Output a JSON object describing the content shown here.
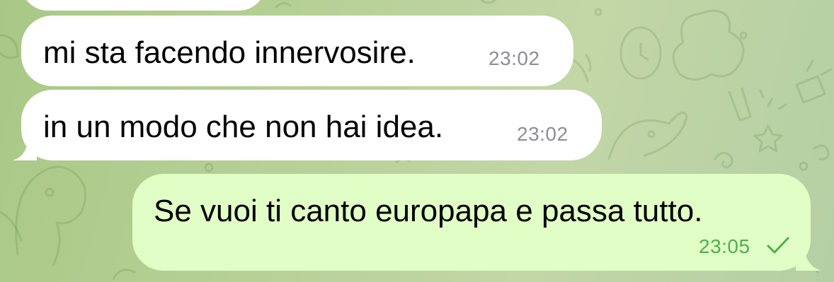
{
  "chat": {
    "messages": [
      {
        "direction": "incoming",
        "text": "mi sta facendo innervosire.",
        "time": "23:02"
      },
      {
        "direction": "incoming",
        "text": "in un modo che non hai idea.",
        "time": "23:02"
      },
      {
        "direction": "outgoing",
        "text": "Se vuoi ti canto europapa e passa tutto.",
        "time": "23:05",
        "status_icon": "single-check-icon"
      }
    ]
  },
  "colors": {
    "incoming_bubble": "#ffffff",
    "outgoing_bubble": "#e1fec6",
    "outgoing_time": "#4fae4e",
    "incoming_time": "#8e8e93",
    "wallpaper": "#b6d096"
  }
}
